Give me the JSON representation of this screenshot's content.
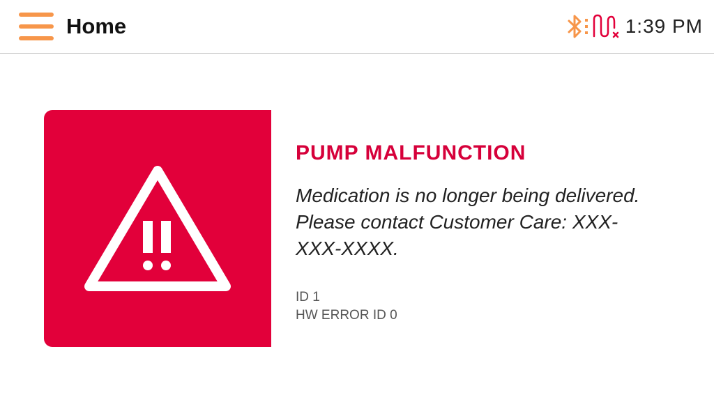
{
  "header": {
    "title": "Home",
    "menu_icon": "hamburger-menu-icon",
    "time": "1:39 PM",
    "status_icons": [
      "bluetooth-icon",
      "sensor-disconnected-icon"
    ]
  },
  "alert": {
    "icon": "warning-triangle-icon",
    "title": "PUMP MALFUNCTION",
    "message": "Medication is no longer being delivered. Please contact Customer Care: XXX-XXX-XXXX.",
    "id_line": "ID 1",
    "hw_error_line": "HW ERROR ID 0"
  },
  "colors": {
    "accent_orange": "#f7964a",
    "alert_red": "#e2003a",
    "title_red": "#d6003a"
  }
}
